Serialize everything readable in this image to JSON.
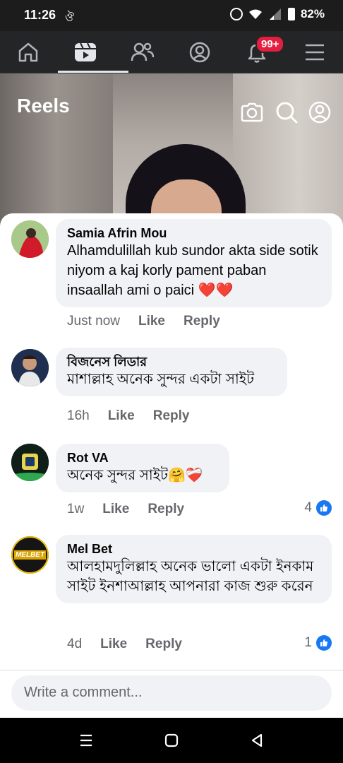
{
  "status_bar": {
    "time": "11:26",
    "sub_icon": "ঔ",
    "battery": "82%"
  },
  "nav": {
    "badge": "99+"
  },
  "reels": {
    "title": "Reels"
  },
  "comments": [
    {
      "author": "Samia Afrin Mou",
      "text": "Alhamdulillah kub sundor akta side sotik niyom a kaj korly pament paban insaallah ami o paici ❤️❤️",
      "time": "Just now",
      "like": "Like",
      "reply": "Reply",
      "count": ""
    },
    {
      "author": "বিজনেস লিডার",
      "text": "মাশাল্লাহ অনেক সুন্দর একটা সাইট",
      "time": "16h",
      "like": "Like",
      "reply": "Reply",
      "count": ""
    },
    {
      "author": "Rot VA",
      "text": "অনেক সুন্দর সাইট🤗❤️‍🩹",
      "time": "1w",
      "like": "Like",
      "reply": "Reply",
      "count": "4"
    },
    {
      "author": "Mel Bet",
      "text": "আলহামদুলিল্লাহ অনেক ভালো একটা ইনকাম সাইট ইনশাআল্লাহ আপনারা কাজ শুরু করেন",
      "time": "4d",
      "like": "Like",
      "reply": "Reply",
      "count": "1"
    }
  ],
  "avatars": {
    "melbet_logo": "MELBET"
  },
  "composer": {
    "placeholder": "Write a comment..."
  },
  "colors": {
    "accent": "#1877f2",
    "badge": "#e41e3f",
    "bubble": "#f0f2f5"
  }
}
